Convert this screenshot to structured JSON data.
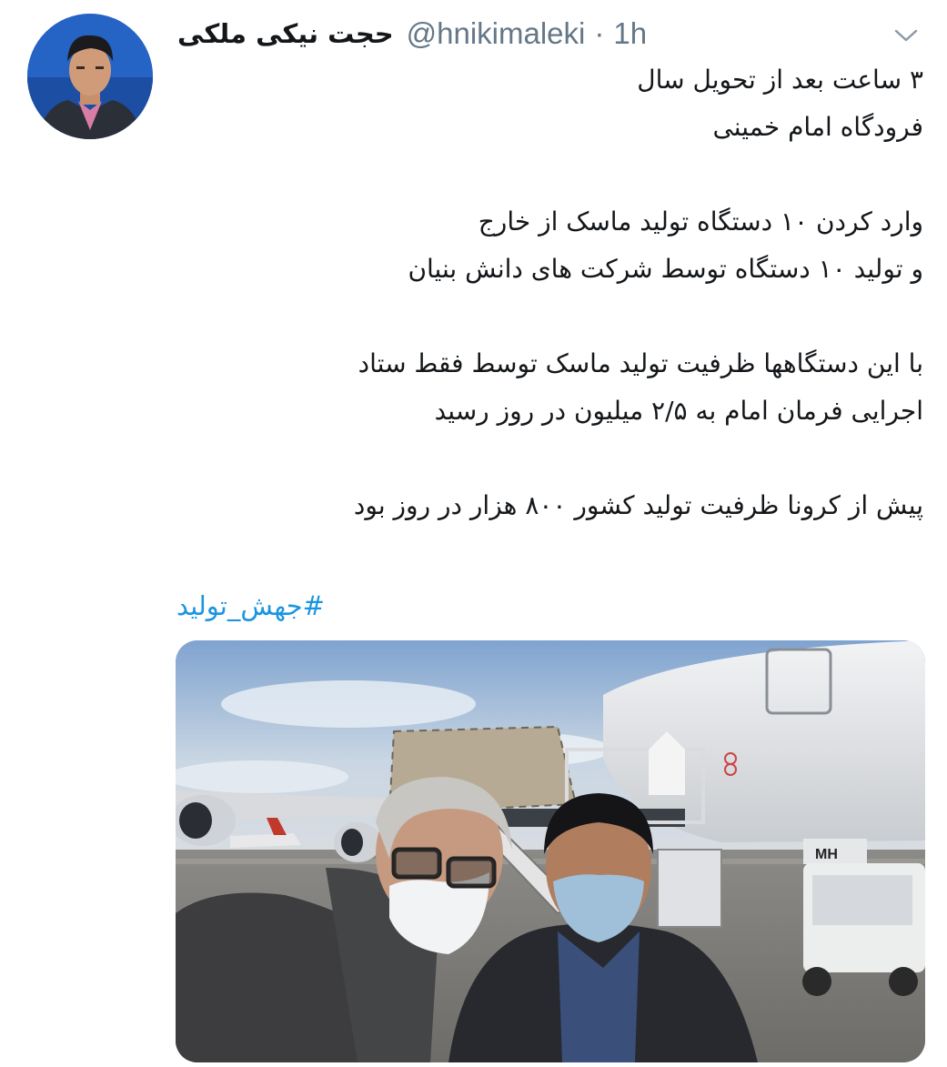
{
  "tweet": {
    "author": {
      "display_name": "حجت نیکی ملکی",
      "handle": "@hnikimaleki",
      "separator": "·",
      "time": "1h"
    },
    "menu_icon": "chevron-down-icon",
    "text_lines": [
      "۳ ساعت بعد از تحویل سال",
      "فرودگاه امام خمینی",
      "",
      "وارد کردن ۱۰ دستگاه تولید ماسک از خارج",
      "و تولید ۱۰ دستگاه توسط شرکت های دانش بنیان",
      "",
      "با این دستگاهها ظرفیت تولید ماسک توسط فقط ستاد",
      "اجرایی فرمان امام به ۲/۵ میلیون در روز رسید",
      "",
      "پیش از کرونا ظرفیت تولید کشور ۸۰۰ هزار در روز بود"
    ],
    "hashtag": "#جهش_تولید",
    "media": {
      "aircraft_tail_code": "MH"
    }
  },
  "colors": {
    "text": "#14171a",
    "secondary": "#657786",
    "link": "#1b95e0"
  }
}
